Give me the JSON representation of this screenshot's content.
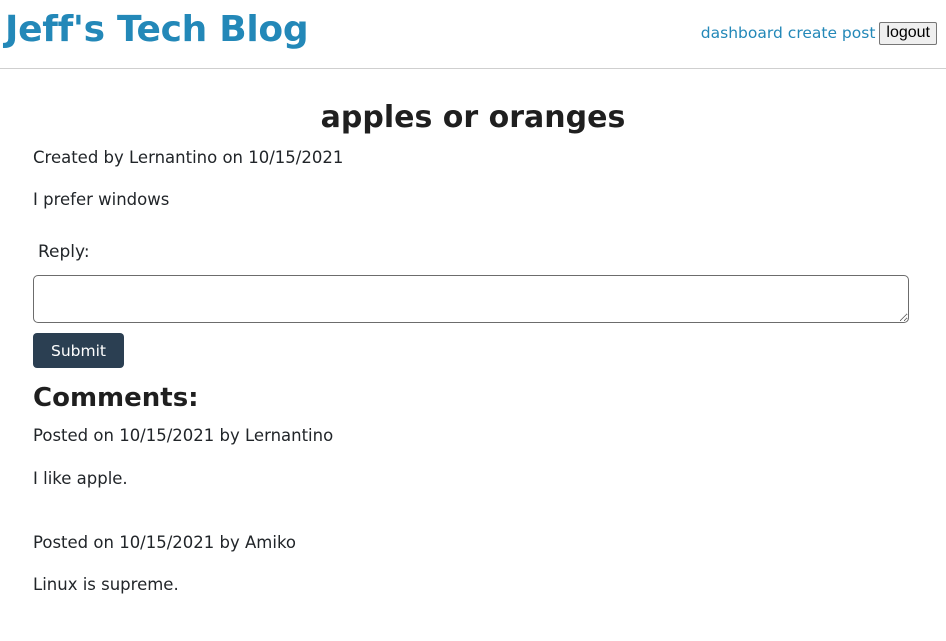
{
  "header": {
    "site_title": "Jeff's Tech Blog",
    "nav": {
      "dashboard": "dashboard",
      "create_post": "create post",
      "logout": "logout"
    }
  },
  "post": {
    "title": "apples or oranges",
    "meta": "Created by Lernantino on 10/15/2021",
    "body": "I prefer windows"
  },
  "reply": {
    "label": "Reply:",
    "value": "",
    "submit_label": "Submit"
  },
  "comments": {
    "heading": "Comments:",
    "items": [
      {
        "meta": "Posted on 10/15/2021 by Lernantino",
        "text": "I like apple."
      },
      {
        "meta": "Posted on 10/15/2021 by Amiko",
        "text": "Linux is supreme."
      }
    ]
  },
  "colors": {
    "brand": "#2388b8",
    "button": "#2b3f52"
  }
}
